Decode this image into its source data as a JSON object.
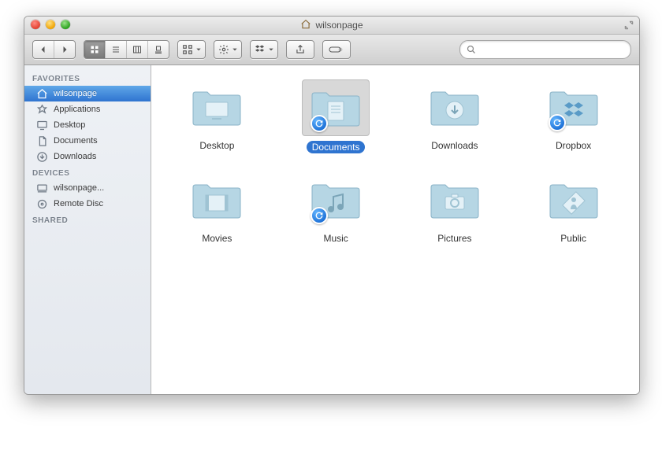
{
  "window": {
    "title": "wilsonpage"
  },
  "toolbar": {
    "search_placeholder": ""
  },
  "sidebar": {
    "sections": [
      {
        "header": "FAVORITES",
        "items": [
          {
            "label": "wilsonpage",
            "icon": "home-icon",
            "selected": true
          },
          {
            "label": "Applications",
            "icon": "applications-icon",
            "selected": false
          },
          {
            "label": "Desktop",
            "icon": "desktop-icon",
            "selected": false
          },
          {
            "label": "Documents",
            "icon": "documents-icon",
            "selected": false
          },
          {
            "label": "Downloads",
            "icon": "downloads-icon",
            "selected": false
          }
        ]
      },
      {
        "header": "DEVICES",
        "items": [
          {
            "label": "wilsonpage...",
            "icon": "computer-icon",
            "selected": false
          },
          {
            "label": "Remote Disc",
            "icon": "disc-icon",
            "selected": false
          }
        ]
      },
      {
        "header": "SHARED",
        "items": []
      }
    ]
  },
  "content": {
    "items": [
      {
        "label": "Desktop",
        "icon": "folder-desktop-icon",
        "sync": false,
        "selected": false
      },
      {
        "label": "Documents",
        "icon": "folder-documents-icon",
        "sync": true,
        "selected": true
      },
      {
        "label": "Downloads",
        "icon": "folder-downloads-icon",
        "sync": false,
        "selected": false
      },
      {
        "label": "Dropbox",
        "icon": "folder-dropbox-icon",
        "sync": true,
        "selected": false
      },
      {
        "label": "Movies",
        "icon": "folder-movies-icon",
        "sync": false,
        "selected": false
      },
      {
        "label": "Music",
        "icon": "folder-music-icon",
        "sync": true,
        "selected": false
      },
      {
        "label": "Pictures",
        "icon": "folder-pictures-icon",
        "sync": false,
        "selected": false
      },
      {
        "label": "Public",
        "icon": "folder-public-icon",
        "sync": false,
        "selected": false
      }
    ]
  }
}
